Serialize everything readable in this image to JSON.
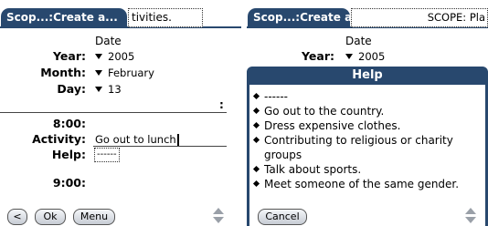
{
  "left_screen": {
    "title": "Scop...:Create a...",
    "title_field": "tivities.",
    "date_header": "Date",
    "year": {
      "label": "Year:",
      "value": "2005"
    },
    "month": {
      "label": "Month:",
      "value": "February"
    },
    "day": {
      "label": "Day:",
      "value": "13"
    },
    "time_800": "8:00:",
    "activity": {
      "label": "Activity:",
      "value": "Go out to lunch"
    },
    "help": {
      "label": "Help:",
      "value": "------"
    },
    "time_900": "9:00:",
    "buttons": {
      "back": "<",
      "ok": "Ok",
      "menu": "Menu"
    }
  },
  "right_screen": {
    "title": "Scop...:Create a...",
    "title_field": "SCOPE: Pla",
    "date_header": "Date",
    "year": {
      "label": "Year:",
      "value": "2005"
    },
    "dialog": {
      "title": "Help",
      "items": [
        "------",
        "Go out to the country.",
        "Dress expensive clothes.",
        "Contributing to religious or charity groups",
        "Talk about sports.",
        "Meet someone of the same gender."
      ],
      "cancel": "Cancel"
    }
  },
  "colors": {
    "titlebar": "#28486e",
    "button_gradient_top": "#f4f6f9",
    "button_gradient_bottom": "#c7ccd4"
  }
}
